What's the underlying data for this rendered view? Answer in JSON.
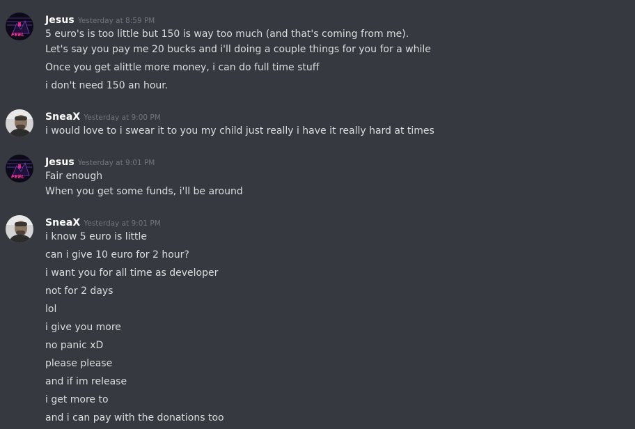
{
  "colors": {
    "background": "#36393f",
    "username": "#ffffff",
    "timestamp": "#72767d",
    "message_text": "#dcddde"
  },
  "messages": [
    {
      "author": "Jesus",
      "avatar_icon": "neon-feel-avatar-icon",
      "timestamp": "Yesterday at 8:59 PM",
      "lines": [
        "5 euro's is too little but 150 is way too much (and that's coming from me).",
        "Let's say you pay me 20 bucks and i'll doing a couple things for you for a while",
        "Once you get alittle more money, i can do full time stuff",
        "i don't need 150 an hour."
      ]
    },
    {
      "author": "SneaX",
      "avatar_icon": "user-photo-avatar-icon",
      "timestamp": "Yesterday at 9:00 PM",
      "lines": [
        "i would love to i swear it to you my child just really i have it really hard at times"
      ]
    },
    {
      "author": "Jesus",
      "avatar_icon": "neon-feel-avatar-icon",
      "timestamp": "Yesterday at 9:01 PM",
      "lines": [
        "Fair enough",
        "When you get some funds, i'll be around"
      ]
    },
    {
      "author": "SneaX",
      "avatar_icon": "user-photo-avatar-icon",
      "timestamp": "Yesterday at 9:01 PM",
      "lines": [
        "i know 5 euro is little",
        "can i give 10 euro for 2 hour?",
        "i want you for all time as developer",
        "not for 2 days",
        "lol",
        "i give you more",
        "no panic xD",
        "please please",
        "and if im release",
        "i get more to",
        "and i can pay with the donations too"
      ]
    }
  ]
}
